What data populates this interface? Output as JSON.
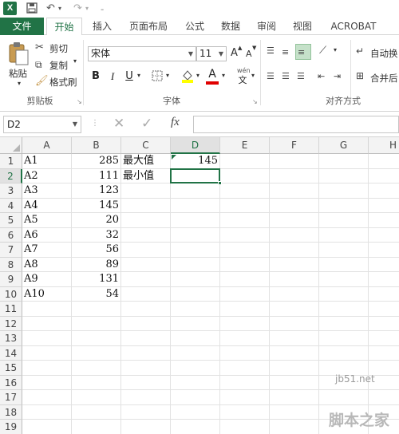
{
  "app": {
    "logo": "X"
  },
  "tabs": {
    "file": "文件",
    "home": "开始",
    "insert": "插入",
    "layout": "页面布局",
    "formulas": "公式",
    "data": "数据",
    "review": "审阅",
    "view": "视图",
    "acrobat": "ACROBAT"
  },
  "clipboard": {
    "paste": "粘贴",
    "cut": "剪切",
    "copy": "复制",
    "painter": "格式刷",
    "label": "剪贴板"
  },
  "font": {
    "name": "宋体",
    "size": "11",
    "label": "字体",
    "grow": "A",
    "shrink": "A",
    "bold": "B",
    "italic": "I",
    "underline": "U",
    "color": "A",
    "phonetic": "文"
  },
  "alignment": {
    "wrap": "自动换",
    "merge": "合并后",
    "label": "对齐方式"
  },
  "formula": {
    "namebox": "D2",
    "fx": "fx",
    "value": ""
  },
  "columns": [
    "A",
    "B",
    "C",
    "D",
    "E",
    "F",
    "G",
    "H"
  ],
  "rows": [
    "1",
    "2",
    "3",
    "4",
    "5",
    "6",
    "7",
    "8",
    "9",
    "10",
    "11",
    "12",
    "13",
    "14",
    "15",
    "16",
    "17",
    "18",
    "19"
  ],
  "cells": {
    "A": [
      "A1",
      "A2",
      "A3",
      "A4",
      "A5",
      "A6",
      "A7",
      "A8",
      "A9",
      "A10"
    ],
    "B": [
      "285",
      "111",
      "123",
      "145",
      "20",
      "32",
      "56",
      "89",
      "131",
      "54"
    ],
    "C1": "最大值",
    "C2": "最小值",
    "D1": "145"
  },
  "watermark": {
    "site": "jb51.net",
    "brand": "脚本之家"
  },
  "colors": {
    "accent": "#217346"
  }
}
